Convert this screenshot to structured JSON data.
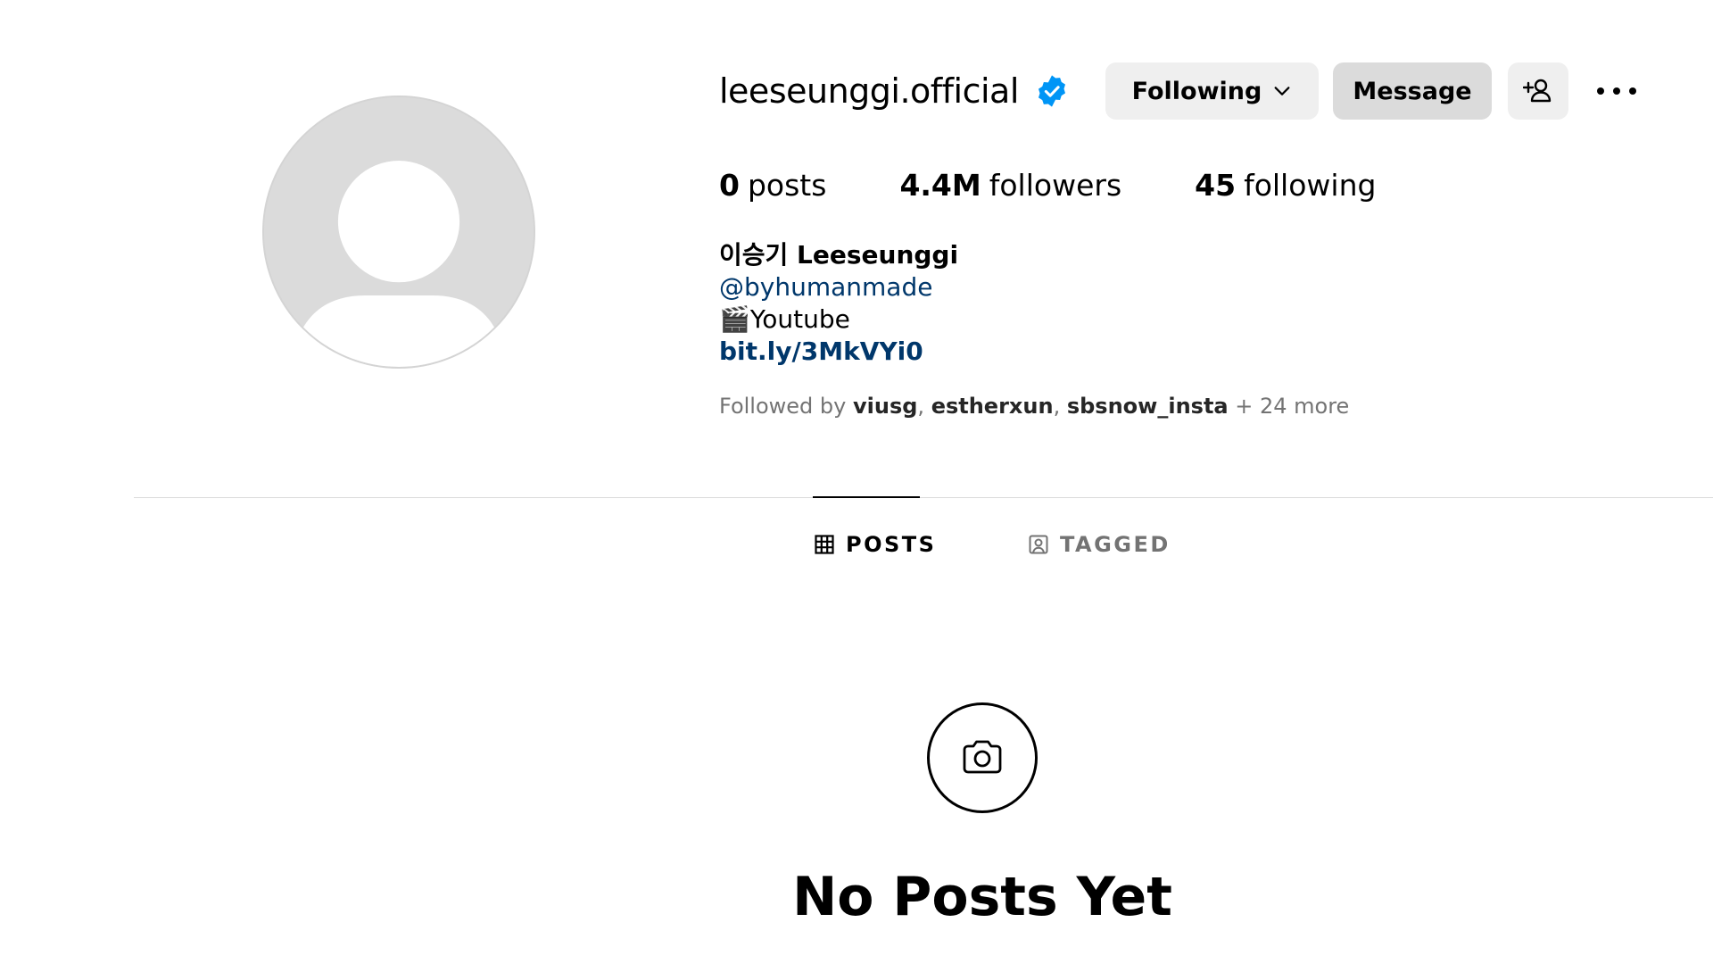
{
  "profile": {
    "username": "leeseunggi.official",
    "verified": true,
    "full_name": "이승기 Leeseunggi",
    "mention": "@byhumanmade",
    "bio_line": "🎬Youtube",
    "link": "bit.ly/3MkVYi0"
  },
  "actions": {
    "following_label": "Following",
    "message_label": "Message",
    "add_user_icon": "person-plus-icon",
    "more_icon": "more-horizontal-icon"
  },
  "stats": {
    "posts_count": "0",
    "posts_label": "posts",
    "followers_count": "4.4M",
    "followers_label": "followers",
    "following_count": "45",
    "following_label": "following"
  },
  "followed_by": {
    "prefix": "Followed by",
    "names": [
      "viusg",
      "estherxun",
      "sbsnow_insta"
    ],
    "suffix": "+ 24 more"
  },
  "tabs": [
    {
      "label": "POSTS",
      "icon": "grid-icon",
      "active": true
    },
    {
      "label": "TAGGED",
      "icon": "tagged-icon",
      "active": false
    }
  ],
  "empty_state": {
    "icon": "camera-icon",
    "title": "No Posts Yet"
  },
  "colors": {
    "verified_blue": "#0095f6",
    "link_blue": "#00376b",
    "secondary_text": "#737373",
    "button_bg": "#efefef",
    "message_bg": "#dbdbdb"
  }
}
